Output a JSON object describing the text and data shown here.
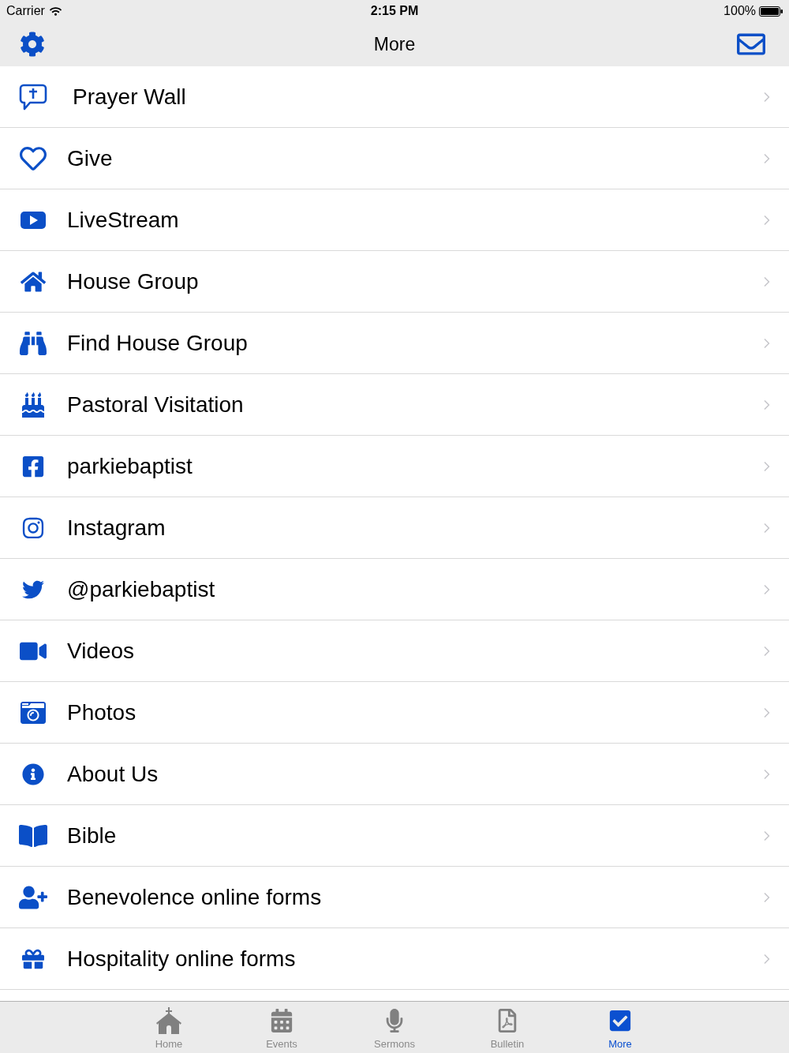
{
  "status_bar": {
    "carrier": "Carrier",
    "time": "2:15 PM",
    "battery": "100%"
  },
  "nav_bar": {
    "title": "More"
  },
  "menu": {
    "items": [
      {
        "label": "Prayer Wall",
        "kind": "prayer"
      },
      {
        "label": "Give",
        "kind": "heart"
      },
      {
        "label": "LiveStream",
        "kind": "play"
      },
      {
        "label": "House Group",
        "kind": "house"
      },
      {
        "label": "Find House Group",
        "kind": "binoculars"
      },
      {
        "label": "Pastoral Visitation",
        "kind": "cake"
      },
      {
        "label": "parkiebaptist",
        "kind": "facebook"
      },
      {
        "label": "Instagram",
        "kind": "instagram"
      },
      {
        "label": "@parkiebaptist",
        "kind": "bird"
      },
      {
        "label": "Videos",
        "kind": "video"
      },
      {
        "label": "Photos",
        "kind": "camera"
      },
      {
        "label": "About Us",
        "kind": "info"
      },
      {
        "label": "Bible",
        "kind": "book"
      },
      {
        "label": "Benevolence online forms",
        "kind": "add_person"
      },
      {
        "label": "Hospitality online forms",
        "kind": "gift"
      }
    ]
  },
  "tab_bar": {
    "tabs": [
      {
        "label": "Home",
        "kind": "church",
        "selected": false
      },
      {
        "label": "Events",
        "kind": "calendar",
        "selected": false
      },
      {
        "label": "Sermons",
        "kind": "microphone",
        "selected": false
      },
      {
        "label": "Bulletin",
        "kind": "document",
        "selected": false
      },
      {
        "label": "More",
        "kind": "checkbox",
        "selected": true
      }
    ]
  }
}
